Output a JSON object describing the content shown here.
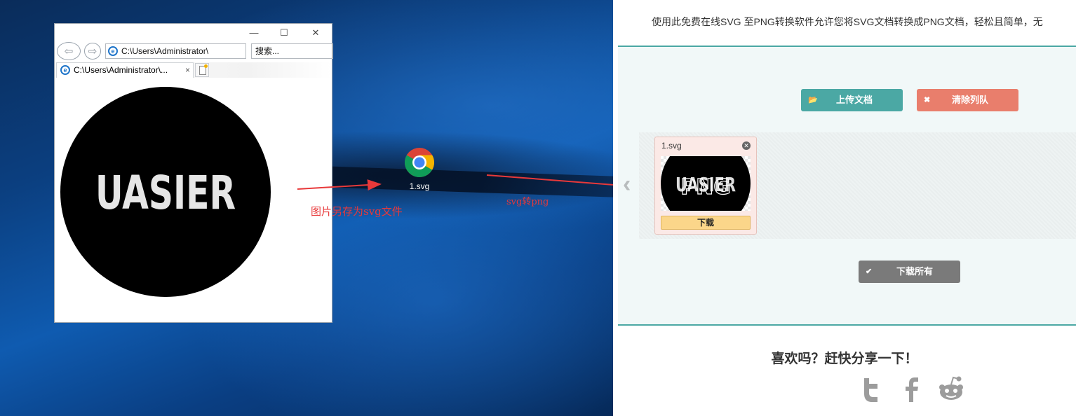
{
  "ie_window": {
    "address": "C:\\Users\\Administrator\\",
    "search_placeholder": "搜索...",
    "tab_title": "C:\\Users\\Administrator\\...",
    "tab_close": "×",
    "svg_text": "UASIER"
  },
  "desktop": {
    "file_name": "1.svg",
    "annotation_save": "图片另存为svg文件",
    "annotation_convert": "svg转png"
  },
  "web": {
    "intro": "使用此免费在线SVG 至PNG转换软件允许您将SVG文档转换成PNG文档，轻松且简单，无",
    "upload_label": "上传文档",
    "clear_label": "清除列队",
    "file_card": {
      "name": "1.svg",
      "thumb_text_1": "UASIER",
      "thumb_text_2": "PNG",
      "download_label": "下载"
    },
    "download_all_label": "下载所有",
    "share_title": "喜欢吗？赶快分享一下！"
  },
  "colors": {
    "teal": "#4ba8a4",
    "salmon": "#e97e6c",
    "gray_button": "#7a7a7a",
    "annotation_red": "#e8393a"
  },
  "icons": [
    "back-arrow-icon",
    "forward-arrow-icon",
    "ie-icon",
    "refresh-icon",
    "chrome-icon",
    "folder-open-icon",
    "x-icon",
    "check-icon",
    "twitter-icon",
    "facebook-icon",
    "reddit-icon",
    "chevron-left-icon"
  ]
}
